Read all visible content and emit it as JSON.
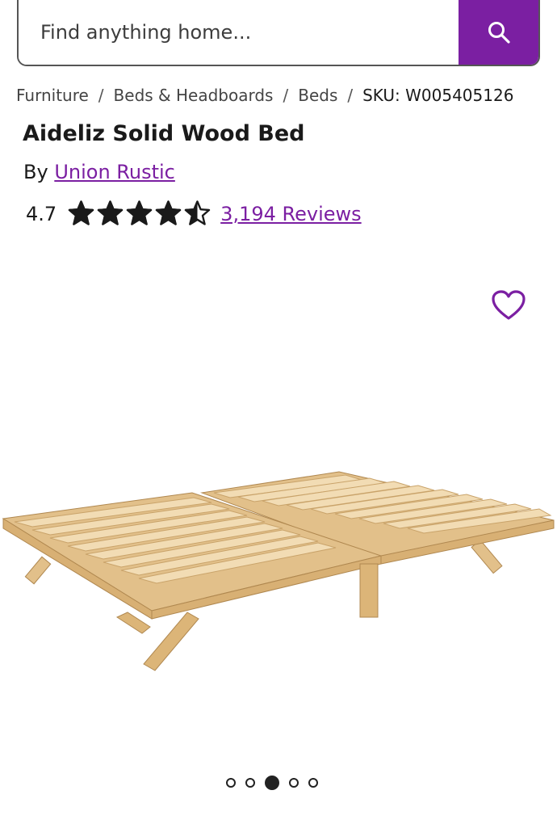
{
  "search": {
    "placeholder": "Find anything home..."
  },
  "breadcrumb": {
    "items": [
      "Furniture",
      "Beds & Headboards",
      "Beds"
    ],
    "sku": "SKU: W005405126"
  },
  "product": {
    "title": "Aideliz Solid Wood Bed",
    "by_prefix": "By",
    "brand": "Union Rustic",
    "rating": "4.7",
    "rating_value": 4.5,
    "reviews": "3,194 Reviews"
  },
  "carousel": {
    "count": 5,
    "active_index": 2
  },
  "colors": {
    "accent": "#7b1fa2",
    "wood": "#e2c08a"
  }
}
